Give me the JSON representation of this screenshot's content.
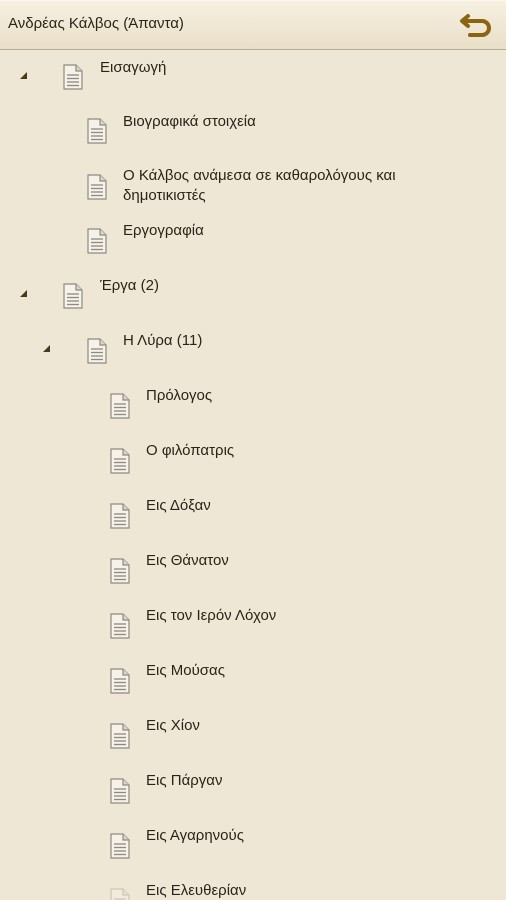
{
  "header": {
    "title": "Ανδρέας Κάλβος (Άπαντα)",
    "back_icon": "undo-arrow-icon",
    "accent": "#8a6410"
  },
  "tree": [
    {
      "label": "Εισαγωγή",
      "level": 0,
      "expanded": true
    },
    {
      "label": "Βιογραφικά στοιχεία",
      "level": 1
    },
    {
      "label": "Ο Κάλβος ανάμεσα σε καθαρολόγους και δημοτικιστές",
      "level": 1
    },
    {
      "label": "Εργογραφία",
      "level": 1
    },
    {
      "label": "Έργα (2)",
      "level": 0,
      "expanded": true
    },
    {
      "label": "Η Λύρα (11)",
      "level": 1,
      "expanded": true
    },
    {
      "label": "Πρόλογος",
      "level": 2
    },
    {
      "label": "Ο φιλόπατρις",
      "level": 2
    },
    {
      "label": "Εις Δόξαν",
      "level": 2
    },
    {
      "label": "Εις Θάνατον",
      "level": 2
    },
    {
      "label": "Εις τον Ιερόν Λόχον",
      "level": 2
    },
    {
      "label": "Εις Μούσας",
      "level": 2
    },
    {
      "label": "Εις Χίον",
      "level": 2
    },
    {
      "label": "Εις Πάργαν",
      "level": 2
    },
    {
      "label": "Εις Αγαρηνούς",
      "level": 2
    },
    {
      "label": "Εις Ελευθερίαν",
      "level": 2
    }
  ]
}
